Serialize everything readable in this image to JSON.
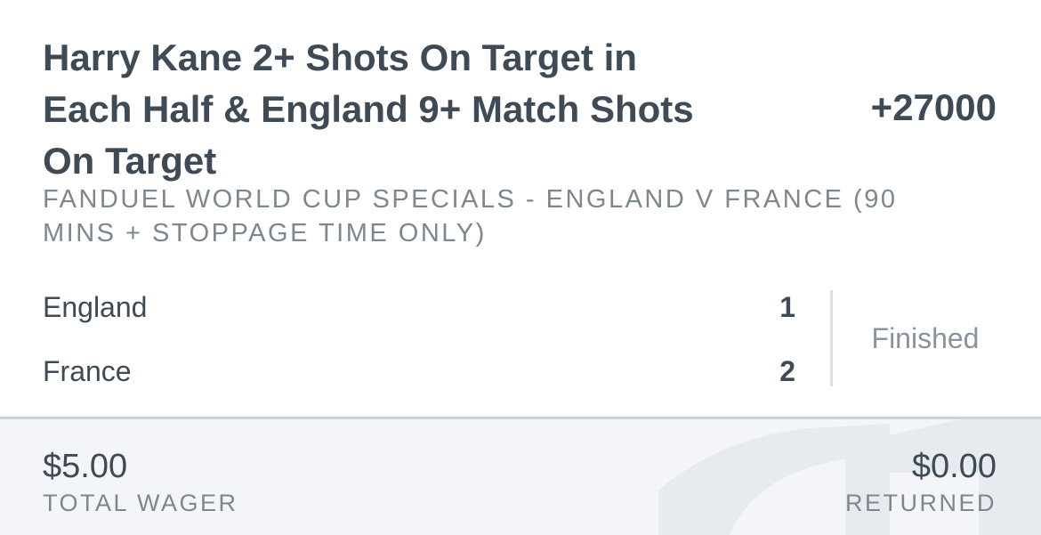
{
  "bet": {
    "title": "Harry Kane 2+ Shots On Target in Each Half & England 9+ Match Shots On Target",
    "odds": "+27000",
    "market": "FANDUEL WORLD CUP SPECIALS - ENGLAND V FRANCE (90 MINS + STOPPAGE TIME ONLY)"
  },
  "match": {
    "teams": [
      {
        "name": "England",
        "score": "1"
      },
      {
        "name": "France",
        "score": "2"
      }
    ],
    "status": "Finished"
  },
  "footer": {
    "wager_amount": "$5.00",
    "wager_label": "TOTAL WAGER",
    "returned_amount": "$0.00",
    "returned_label": "RETURNED"
  },
  "colors": {
    "text_primary": "#3e4a55",
    "text_secondary": "#7d8790",
    "footer_background": "#f3f5f8"
  }
}
